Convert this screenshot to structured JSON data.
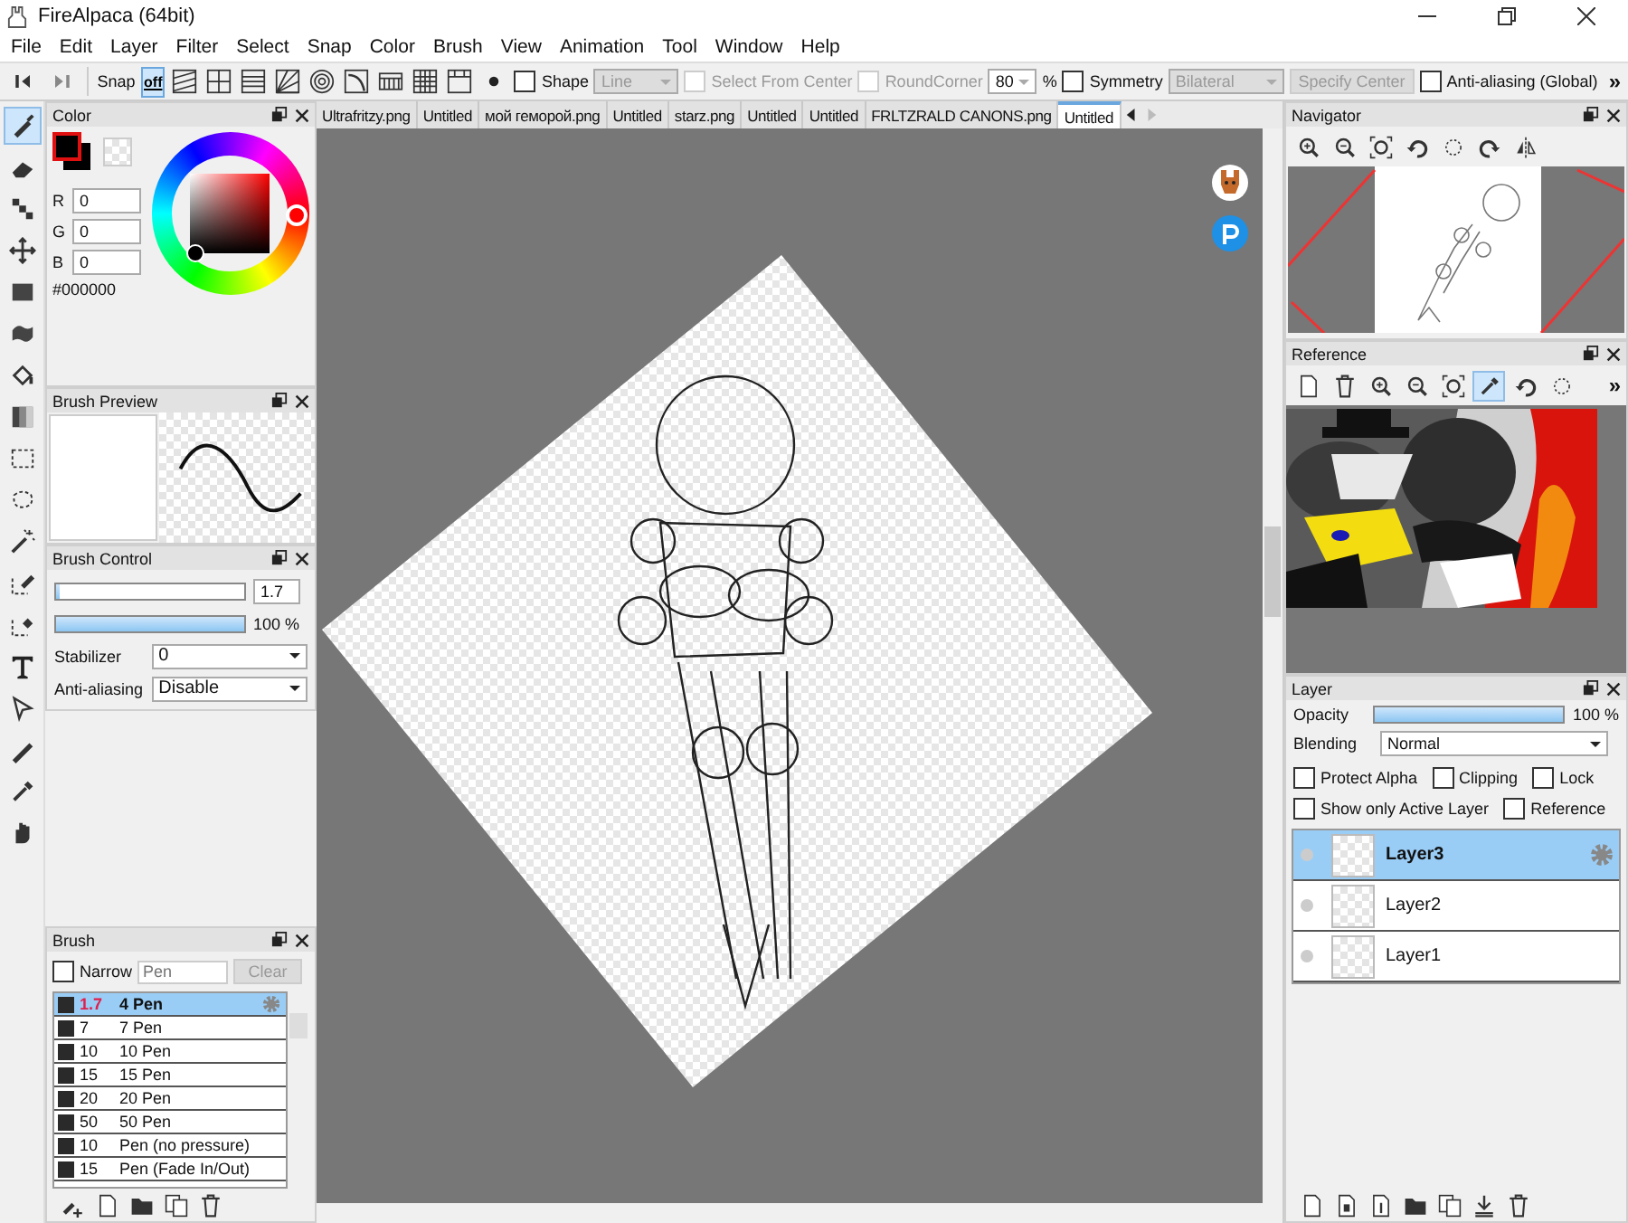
{
  "window": {
    "title": "FireAlpaca (64bit)"
  },
  "menu": [
    "File",
    "Edit",
    "Layer",
    "Filter",
    "Select",
    "Snap",
    "Color",
    "Brush",
    "View",
    "Animation",
    "Tool",
    "Window",
    "Help"
  ],
  "toolbar": {
    "frame_buttons": [
      {
        "kind": "prev-frame"
      },
      {
        "kind": "next-frame"
      }
    ],
    "snap_label": "Snap",
    "snap_modes": [
      {
        "kind": "snap-off",
        "label": "off",
        "selected": true
      },
      {
        "kind": "snap-parallel",
        "selected": false
      },
      {
        "kind": "snap-cross",
        "selected": false
      },
      {
        "kind": "snap-lines",
        "selected": false
      },
      {
        "kind": "snap-radial",
        "selected": false
      },
      {
        "kind": "snap-circle",
        "selected": false
      },
      {
        "kind": "snap-curve",
        "selected": false
      },
      {
        "kind": "snap-perspective",
        "selected": false
      },
      {
        "kind": "snap-grid",
        "selected": false
      },
      {
        "kind": "snap-frame",
        "selected": false
      },
      {
        "kind": "snap-dot",
        "selected": false
      }
    ],
    "shape": {
      "label": "Shape",
      "checked": false,
      "value": "Line"
    },
    "select_from_center": {
      "label": "Select From Center",
      "checked": false,
      "disabled": true
    },
    "round_corner": {
      "label": "RoundCorner",
      "checked": false,
      "disabled": true,
      "value": "80",
      "unit": "%"
    },
    "symmetry": {
      "label": "Symmetry",
      "checked": false,
      "value": "Bilateral"
    },
    "specify_center": {
      "label": "Specify Center",
      "disabled": true
    },
    "anti_aliasing": {
      "label": "Anti-aliasing (Global)",
      "checked": false
    },
    "overflow": "»"
  },
  "tools": [
    {
      "kind": "brush",
      "selected": true
    },
    {
      "kind": "eraser",
      "selected": false
    },
    {
      "kind": "dots",
      "selected": false
    },
    {
      "kind": "move-arrows",
      "selected": false
    },
    {
      "kind": "filled-rectangle",
      "selected": false
    },
    {
      "kind": "blob",
      "selected": false
    },
    {
      "kind": "bucket",
      "selected": false
    },
    {
      "kind": "gradient",
      "selected": false
    },
    {
      "kind": "dashed-rectangle",
      "selected": false
    },
    {
      "kind": "dashed-lasso",
      "selected": false
    },
    {
      "kind": "magic-wand",
      "selected": false
    },
    {
      "kind": "select-pen",
      "selected": false
    },
    {
      "kind": "select-eraser",
      "selected": false
    },
    {
      "kind": "text-tool",
      "selected": false
    },
    {
      "kind": "pointer-arrow",
      "selected": false
    },
    {
      "kind": "pen",
      "selected": false
    },
    {
      "kind": "eyedropper",
      "selected": false
    },
    {
      "kind": "hand",
      "selected": false
    }
  ],
  "color_panel": {
    "title": "Color",
    "channels": [
      {
        "label": "R",
        "value": "0"
      },
      {
        "label": "G",
        "value": "0"
      },
      {
        "label": "B",
        "value": "0"
      }
    ],
    "hex": "#000000"
  },
  "brush_preview": {
    "title": "Brush Preview"
  },
  "brush_control": {
    "title": "Brush Control",
    "size": {
      "level": 0.02,
      "value": "1.7"
    },
    "opacity": {
      "level": 1,
      "value": "100 %"
    },
    "stabilizer": {
      "label": "Stabilizer",
      "value": "0"
    },
    "anti_aliasing": {
      "label": "Anti-aliasing",
      "value": "Disable"
    }
  },
  "brush_panel": {
    "title": "Brush",
    "narrow": {
      "label": "Narrow",
      "checked": false
    },
    "search": {
      "placeholder": "Pen"
    },
    "clear": {
      "label": "Clear",
      "disabled": true
    },
    "brushes": [
      {
        "size": "1.7",
        "name": "4 Pen",
        "selected": true
      },
      {
        "size": "7",
        "name": "7 Pen",
        "selected": false
      },
      {
        "size": "10",
        "name": "10 Pen",
        "selected": false
      },
      {
        "size": "15",
        "name": "15 Pen",
        "selected": false
      },
      {
        "size": "20",
        "name": "20 Pen",
        "selected": false
      },
      {
        "size": "50",
        "name": "50 Pen",
        "selected": false
      },
      {
        "size": "10",
        "name": "Pen (no pressure)",
        "selected": false
      },
      {
        "size": "15",
        "name": "Pen (Fade In/Out)",
        "selected": false
      }
    ],
    "bottom_tools": [
      {
        "kind": "add-brush"
      },
      {
        "kind": "new-page"
      },
      {
        "kind": "folder"
      },
      {
        "kind": "duplicate"
      },
      {
        "kind": "trash"
      }
    ]
  },
  "tabs": [
    {
      "label": "Ultrafritzy.png",
      "selected": false
    },
    {
      "label": "Untitled",
      "selected": false
    },
    {
      "label": "мой геморой.png",
      "selected": false
    },
    {
      "label": "Untitled",
      "selected": false
    },
    {
      "label": "starz.png",
      "selected": false
    },
    {
      "label": "Untitled",
      "selected": false
    },
    {
      "label": "Untitled",
      "selected": false
    },
    {
      "label": "FRLTZRALD CANONS.png",
      "selected": false
    },
    {
      "label": "Untitled",
      "selected": true
    }
  ],
  "navigator": {
    "title": "Navigator",
    "tools": [
      {
        "kind": "zoom-in"
      },
      {
        "kind": "zoom-out"
      },
      {
        "kind": "zoom-fit"
      },
      {
        "kind": "rotate-left"
      },
      {
        "kind": "rotate-reset"
      },
      {
        "kind": "rotate-right"
      },
      {
        "kind": "flip"
      }
    ]
  },
  "reference": {
    "title": "Reference",
    "tools": [
      {
        "kind": "new-page",
        "selected": false
      },
      {
        "kind": "trash",
        "selected": false
      },
      {
        "kind": "zoom-in",
        "selected": false
      },
      {
        "kind": "zoom-out",
        "selected": false
      },
      {
        "kind": "zoom-fit",
        "selected": false
      },
      {
        "kind": "eyedropper",
        "selected": true
      },
      {
        "kind": "rotate-left",
        "selected": false
      },
      {
        "kind": "rotate-reset",
        "selected": false
      }
    ],
    "overflow": "»"
  },
  "layer_panel": {
    "title": "Layer",
    "opacity": {
      "label": "Opacity",
      "level": 1,
      "value": "100 %"
    },
    "blending": {
      "label": "Blending",
      "value": "Normal"
    },
    "options": [
      {
        "label": "Protect Alpha",
        "checked": false
      },
      {
        "label": "Clipping",
        "checked": false
      },
      {
        "label": "Lock",
        "checked": false
      },
      {
        "label": "Show only Active Layer",
        "checked": false
      },
      {
        "label": "Reference",
        "checked": false
      }
    ],
    "layers": [
      {
        "name": "Layer3",
        "selected": true
      },
      {
        "name": "Layer2",
        "selected": false
      },
      {
        "name": "Layer1",
        "selected": false
      }
    ],
    "bottom_tools": [
      {
        "kind": "new-page"
      },
      {
        "kind": "new-8bit-page"
      },
      {
        "kind": "new-1bit-page"
      },
      {
        "kind": "folder"
      },
      {
        "kind": "duplicate"
      },
      {
        "kind": "merge-down"
      },
      {
        "kind": "trash"
      }
    ]
  }
}
